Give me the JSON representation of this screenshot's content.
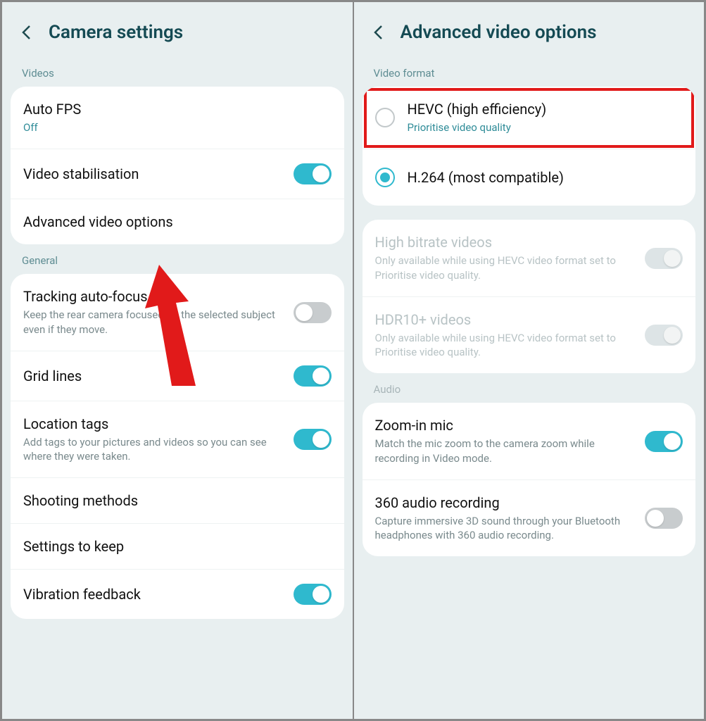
{
  "left": {
    "title": "Camera settings",
    "sections": {
      "videos": {
        "label": "Videos",
        "auto_fps": {
          "title": "Auto FPS",
          "status": "Off"
        },
        "stabilisation": {
          "title": "Video stabilisation"
        },
        "advanced": {
          "title": "Advanced video options"
        }
      },
      "general": {
        "label": "General",
        "tracking": {
          "title": "Tracking auto-focus",
          "sub": "Keep the rear camera focused on the selected subject even if they move."
        },
        "grid": {
          "title": "Grid lines"
        },
        "location": {
          "title": "Location tags",
          "sub": "Add tags to your pictures and videos so you can see where they were taken."
        },
        "shooting": {
          "title": "Shooting methods"
        },
        "keep": {
          "title": "Settings to keep"
        },
        "vibration": {
          "title": "Vibration feedback"
        }
      }
    }
  },
  "right": {
    "title": "Advanced video options",
    "sections": {
      "format": {
        "label": "Video format",
        "hevc": {
          "title": "HEVC (high efficiency)",
          "sub": "Prioritise video quality"
        },
        "h264": {
          "title": "H.264 (most compatible)"
        }
      },
      "extras": {
        "high_bitrate": {
          "title": "High bitrate videos",
          "sub": "Only available while using HEVC video format set to Prioritise video quality."
        },
        "hdr10": {
          "title": "HDR10+ videos",
          "sub": "Only available while using HEVC video format set to Prioritise video quality."
        }
      },
      "audio": {
        "label": "Audio",
        "zoom_mic": {
          "title": "Zoom-in mic",
          "sub": "Match the mic zoom to the camera zoom while recording in Video mode."
        },
        "audio360": {
          "title": "360 audio recording",
          "sub": "Capture immersive 3D sound through your Bluetooth headphones with 360 audio recording."
        }
      }
    }
  }
}
